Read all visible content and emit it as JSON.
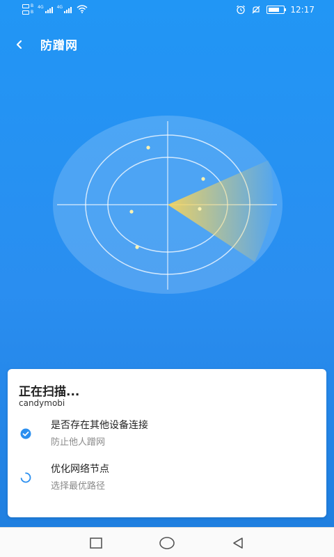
{
  "status_bar": {
    "sim1_label": "B",
    "sim2_label": "B",
    "net1_label": "4G",
    "net2_label": "4G",
    "time": "12:17",
    "icons": [
      "alarm-icon",
      "mute-icon",
      "battery-icon",
      "wifi-icon",
      "signal-icon"
    ]
  },
  "header": {
    "back_icon": "chevron-left-icon",
    "title": "防蹭网"
  },
  "radar": {
    "icons": [
      "radar-sweep",
      "device-dot"
    ],
    "accent": "#f4d35e"
  },
  "scan_card": {
    "title": "正在扫描...",
    "network_name": "candymobi",
    "items": [
      {
        "title": "是否存在其他设备连接",
        "desc": "防止他人蹭网",
        "icon": "check-circle-icon",
        "state": "done"
      },
      {
        "title": "优化网络节点",
        "desc": "选择最优路径",
        "icon": "loading-spinner-icon",
        "state": "in-progress"
      }
    ]
  },
  "colors": {
    "primary": "#2196f5",
    "accent_blue": "#2b8fef",
    "text_dark": "#222222",
    "text_muted": "#8a8a8a"
  },
  "nav_bar": {
    "icons": [
      "recent-apps-icon",
      "home-icon",
      "back-triangle-icon"
    ]
  }
}
